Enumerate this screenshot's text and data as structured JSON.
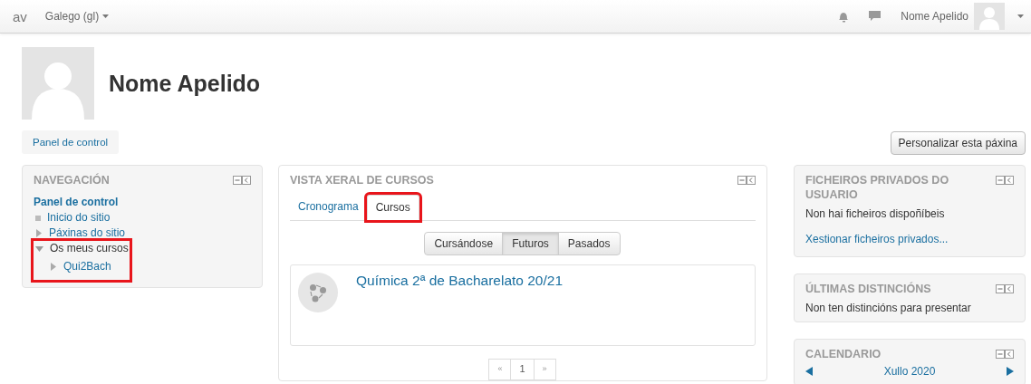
{
  "navbar": {
    "brand": "av",
    "language": "Galego (gl)",
    "user_name": "Nome Apelido"
  },
  "profile": {
    "name": "Nome Apelido"
  },
  "breadcrumb": {
    "label": "Panel de control"
  },
  "customize_button": "Personalizar esta páxina",
  "navigation": {
    "title": "NAVEGACIÓN",
    "root": "Panel de control",
    "items": [
      {
        "label": "Inicio do sitio",
        "kind": "link",
        "highlighted": false
      },
      {
        "label": "Páxinas do sitio",
        "kind": "branch",
        "expanded": false,
        "highlighted": false
      },
      {
        "label": "Os meus cursos",
        "kind": "branch",
        "expanded": true,
        "highlighted": true,
        "children": [
          {
            "label": "Qui2Bach",
            "kind": "branch",
            "expanded": false,
            "highlighted": false
          }
        ]
      }
    ]
  },
  "course_overview": {
    "title": "VISTA XERAL DE CURSOS",
    "tabs": [
      {
        "label": "Cronograma",
        "selected": false,
        "highlighted": false
      },
      {
        "label": "Cursos",
        "selected": true,
        "highlighted": true
      }
    ],
    "filters": [
      {
        "label": "Cursándose",
        "selected": false
      },
      {
        "label": "Futuros",
        "selected": true
      },
      {
        "label": "Pasados",
        "selected": false
      }
    ],
    "courses": [
      {
        "title": "Química 2ª de Bacharelato 20/21"
      }
    ],
    "pagination": [
      {
        "label": "«",
        "selected": false
      },
      {
        "label": "1",
        "selected": true
      },
      {
        "label": "»",
        "selected": false
      }
    ]
  },
  "private_files": {
    "title": "FICHEIROS PRIVADOS DO USUARIO",
    "text": "Non hai ficheiros dispoñíbeis",
    "link": "Xestionar ficheiros privados..."
  },
  "badges": {
    "title": "ÚLTIMAS DISTINCIÓNS",
    "text": "Non ten distincións para presentar"
  },
  "calendar": {
    "title": "CALENDARIO",
    "month": "Xullo 2020"
  }
}
